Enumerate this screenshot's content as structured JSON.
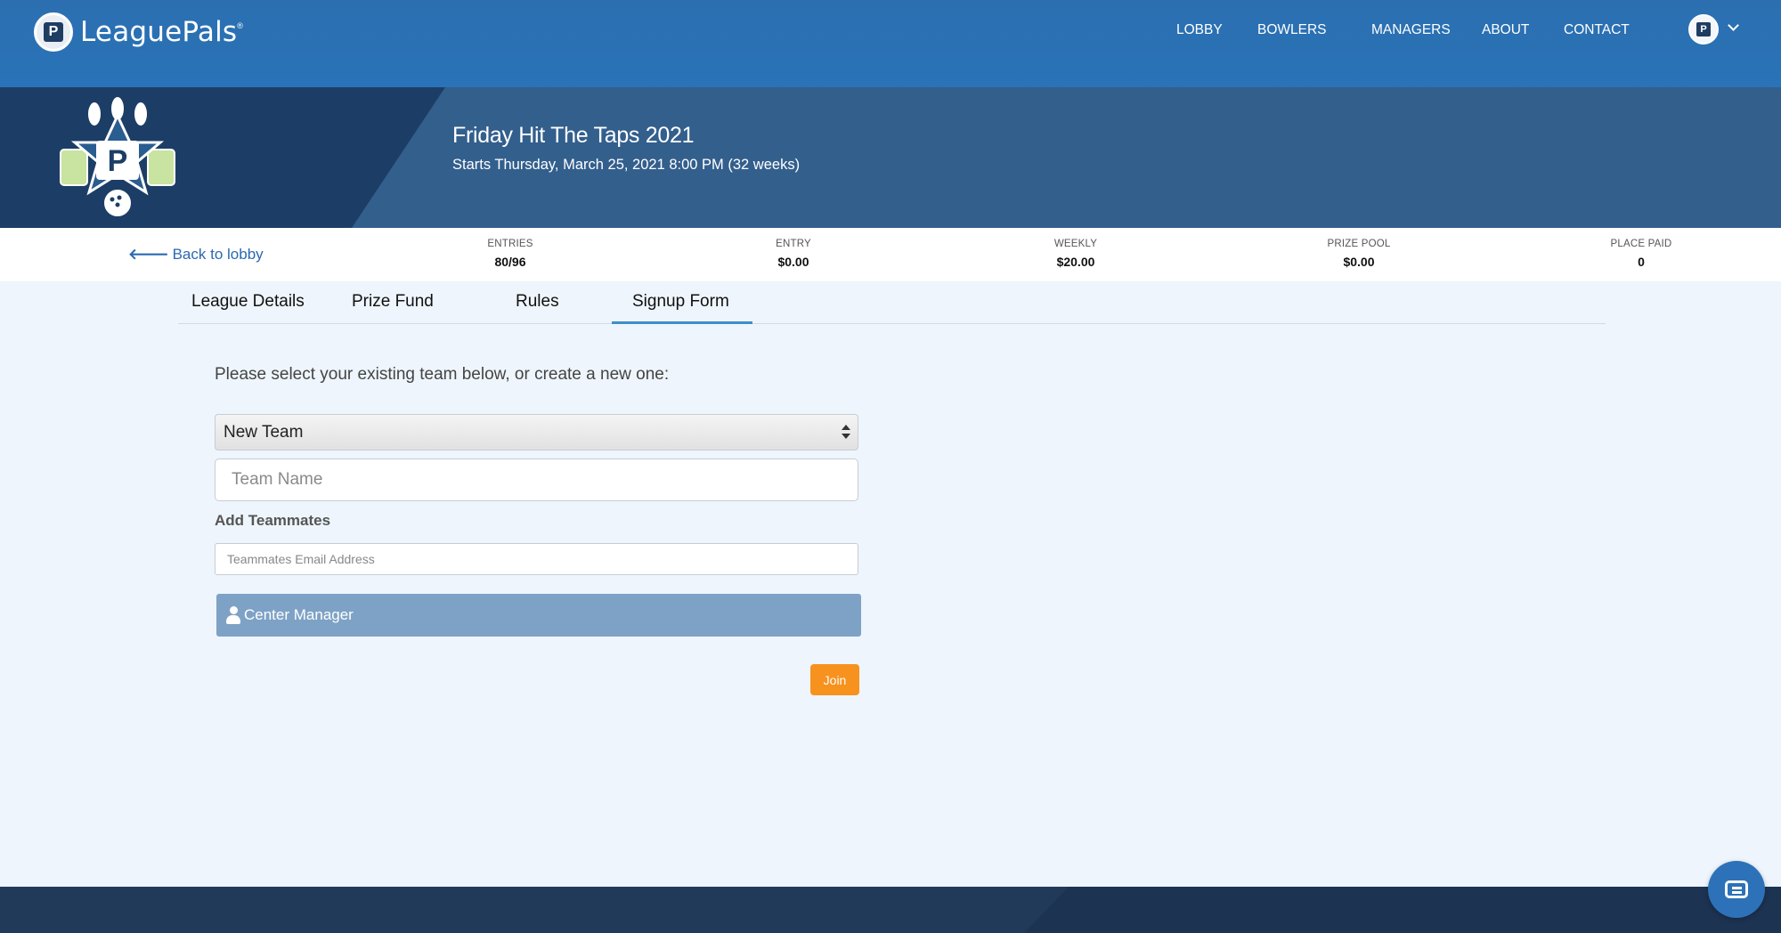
{
  "nav": {
    "brand": "LeaguePals",
    "links": [
      "LOBBY",
      "BOWLERS",
      "MANAGERS",
      "ABOUT",
      "CONTACT"
    ]
  },
  "banner": {
    "title": "Friday Hit The Taps 2021",
    "subtitle": "Starts Thursday, March 25, 2021 8:00 PM (32 weeks)"
  },
  "stats": {
    "back": "Back to lobby",
    "items": [
      {
        "label": "ENTRIES",
        "value": "80/96"
      },
      {
        "label": "ENTRY",
        "value": "$0.00"
      },
      {
        "label": "WEEKLY",
        "value": "$20.00"
      },
      {
        "label": "PRIZE POOL",
        "value": "$0.00"
      },
      {
        "label": "PLACE PAID",
        "value": "0"
      }
    ]
  },
  "tabs": [
    "League Details",
    "Prize Fund",
    "Rules",
    "Signup Form"
  ],
  "active_tab": "Signup Form",
  "form": {
    "intro": "Please select your existing team below, or create a new one:",
    "team_select": "New Team",
    "team_name_placeholder": "Team Name",
    "add_teammates": "Add Teammates",
    "email_placeholder": "Teammates Email Address",
    "center_manager": "Center Manager",
    "join": "Join"
  },
  "colors": {
    "nav": "#2a73b8",
    "banner": "#335f8d",
    "banner_dark": "#1c3e66",
    "accent": "#f7921e",
    "manager_bar": "#7ea2c5"
  }
}
